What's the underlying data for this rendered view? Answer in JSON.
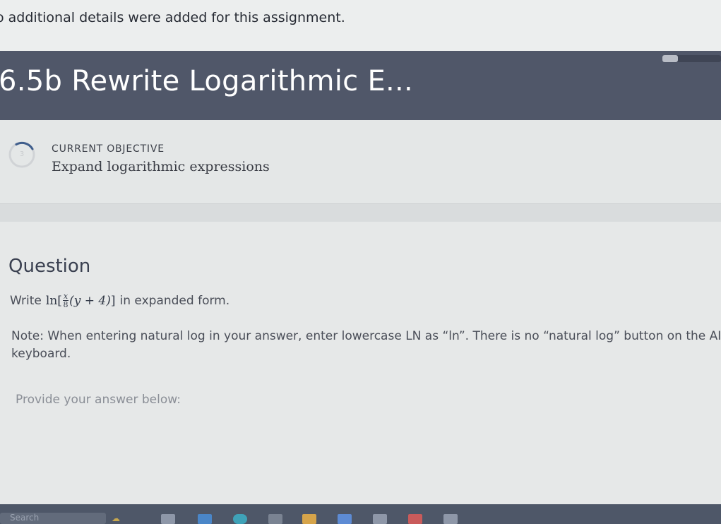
{
  "notice": {
    "text": "o additional details were added for this assignment."
  },
  "header": {
    "title": "6.5b Rewrite Logarithmic E..."
  },
  "objective": {
    "label": "CURRENT OBJECTIVE",
    "text": "Expand logarithmic expressions",
    "ring_value": "3"
  },
  "question": {
    "heading": "Question",
    "prompt_before": "Write",
    "math": {
      "ln": "ln",
      "numerator": "x",
      "denominator": "8",
      "open": "[",
      "inner": "(y + 4)",
      "close": "]"
    },
    "prompt_after": "in expanded form.",
    "note": "Note: When entering natural log in your answer, enter lowercase LN as “ln”. There is no “natural log” button on the AI keyboard.",
    "answer_label": "Provide your answer below:"
  },
  "taskbar": {
    "search_label": "Search"
  },
  "colors": {
    "header_bg": "#505769",
    "page_bg": "#e6e8e8",
    "taskbar_bg": "#4e5768"
  },
  "icons": [
    "progress-ring-icon",
    "search-icon",
    "weather-icon",
    "file-explorer-icon",
    "edge-icon",
    "store-icon"
  ]
}
